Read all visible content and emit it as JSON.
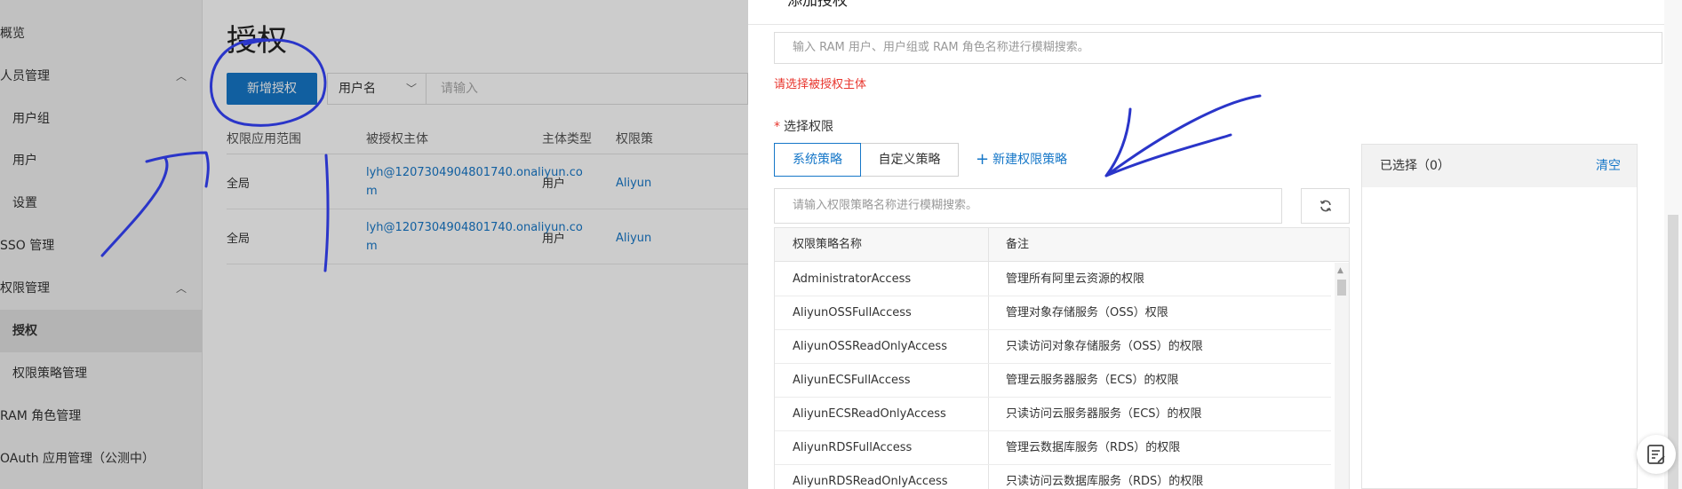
{
  "sidebar": {
    "items": [
      {
        "label": "概览",
        "level": "top"
      },
      {
        "label": "人员管理",
        "level": "top",
        "expanded": true
      },
      {
        "label": "用户组",
        "level": "sub"
      },
      {
        "label": "用户",
        "level": "sub"
      },
      {
        "label": "设置",
        "level": "sub"
      },
      {
        "label": "SSO 管理",
        "level": "top"
      },
      {
        "label": "权限管理",
        "level": "top",
        "expanded": true
      },
      {
        "label": "授权",
        "level": "sub",
        "active": true
      },
      {
        "label": "权限策略管理",
        "level": "sub"
      },
      {
        "label": "RAM 角色管理",
        "level": "top"
      },
      {
        "label": "OAuth 应用管理（公测中）",
        "level": "top"
      }
    ],
    "collapse_icon": "chevron-left-icon"
  },
  "main": {
    "title": "授权",
    "add_button": "新增授权",
    "filter_select": "用户名",
    "filter_placeholder": "请输入",
    "columns": [
      "权限应用范围",
      "被授权主体",
      "主体类型",
      "权限策"
    ],
    "rows": [
      {
        "scope": "全局",
        "principal_line1": "lyh@1207304904801740.onaliyun.co",
        "principal_line2": "m",
        "type": "用户",
        "policy": "Aliyun"
      },
      {
        "scope": "全局",
        "principal_line1": "lyh@1207304904801740.onaliyun.co",
        "principal_line2": "m",
        "type": "用户",
        "policy": "Aliyun"
      }
    ]
  },
  "drawer": {
    "title": "添加授权",
    "principal_placeholder": "输入 RAM 用户、用户组或 RAM 角色名称进行模糊搜索。",
    "principal_error": "请选择被授权主体",
    "perm_required_mark": "*",
    "perm_label": "选择权限",
    "tab_system": "系统策略",
    "tab_custom": "自定义策略",
    "new_policy_plus": "+",
    "new_policy": "新建权限策略",
    "policy_search_placeholder": "请输入权限策略名称进行模糊搜索。",
    "refresh_icon": "refresh-icon",
    "table_headers": [
      "权限策略名称",
      "备注"
    ],
    "policies": [
      {
        "name": "AdministratorAccess",
        "note": "管理所有阿里云资源的权限"
      },
      {
        "name": "AliyunOSSFullAccess",
        "note": "管理对象存储服务（OSS）权限"
      },
      {
        "name": "AliyunOSSReadOnlyAccess",
        "note": "只读访问对象存储服务（OSS）的权限"
      },
      {
        "name": "AliyunECSFullAccess",
        "note": "管理云服务器服务（ECS）的权限"
      },
      {
        "name": "AliyunECSReadOnlyAccess",
        "note": "只读访问云服务器服务（ECS）的权限"
      },
      {
        "name": "AliyunRDSFullAccess",
        "note": "管理云数据库服务（RDS）的权限"
      },
      {
        "name": "AliyunRDSReadOnlyAccess",
        "note": "只读访问云数据库服务（RDS）的权限"
      }
    ],
    "selected_label": "已选择（0）",
    "clear_label": "清空",
    "feedback_icon": "feedback-icon"
  },
  "colors": {
    "primary": "#1677c8",
    "error": "#e8352d",
    "annotation_ink": "#2a35c9"
  }
}
